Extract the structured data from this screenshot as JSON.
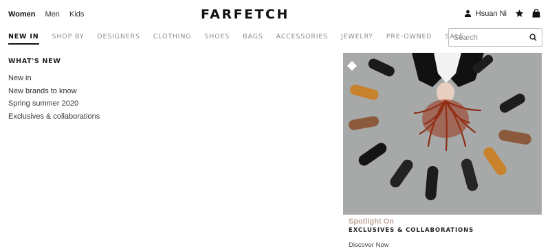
{
  "gender_tabs": [
    {
      "label": "Women",
      "active": true
    },
    {
      "label": "Men"
    },
    {
      "label": "Kids"
    }
  ],
  "brand": {
    "logo_text": "FARFETCH"
  },
  "account": {
    "user_name": "Hsuan Ni",
    "icons": [
      "user-icon",
      "wishlist-star-icon",
      "shopping-bag-icon"
    ]
  },
  "nav": {
    "items": [
      "NEW IN",
      "SHOP BY",
      "DESIGNERS",
      "CLOTHING",
      "SHOES",
      "BAGS",
      "ACCESSORIES",
      "JEWELRY",
      "PRE-OWNED",
      "SALE"
    ]
  },
  "search": {
    "placeholder": "Search",
    "icon": "search-icon"
  },
  "whats_new": {
    "title": "WHAT'S NEW",
    "links": [
      "New in",
      "New brands to know",
      "Spring summer 2020",
      "Exclusives & collaborations"
    ]
  },
  "spotlight": {
    "kicker": "Spotlight On",
    "title": "EXCLUSIVES & COLLABORATIONS",
    "link": "Discover Now"
  },
  "colors": {
    "promo_background": "#a7a9a8",
    "kicker": "#c2a89a",
    "nav_inactive": "#8e8e8e"
  }
}
